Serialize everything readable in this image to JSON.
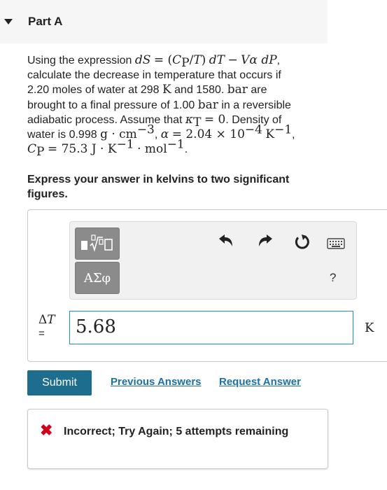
{
  "part": {
    "title": "Part A"
  },
  "problem": {
    "s1": "Using the expression ",
    "s2": ",",
    "s3": "calculate the decrease in temperature that occurs if",
    "s4": "2.20 moles of water at 298 ",
    "s5": " and 1580. ",
    "s6": " are",
    "s7": "brought to a final pressure of 1.00 ",
    "s8": " in a reversible",
    "s9": "adiabatic process. Assume that ",
    "s10": ". Density of",
    "s11": "water is 0.998 ",
    "s12": ", ",
    "s13": ",",
    "s14": "."
  },
  "instruction": "Express your answer in kelvins to two significant figures.",
  "toolbar": {
    "greek_label": "ΑΣφ",
    "help_label": "?"
  },
  "answer": {
    "value": "5.68",
    "unit": "K"
  },
  "actions": {
    "submit": "Submit",
    "previous_answers": "Previous Answers",
    "request_answer": "Request Answer"
  },
  "feedback": {
    "icon": "✖",
    "message": "Incorrect; Try Again; 5 attempts remaining"
  },
  "colors": {
    "submit_bg": "#1d6e8e",
    "link": "#1c70a8",
    "error": "#d0021b",
    "input_border": "#1e8cc0"
  }
}
